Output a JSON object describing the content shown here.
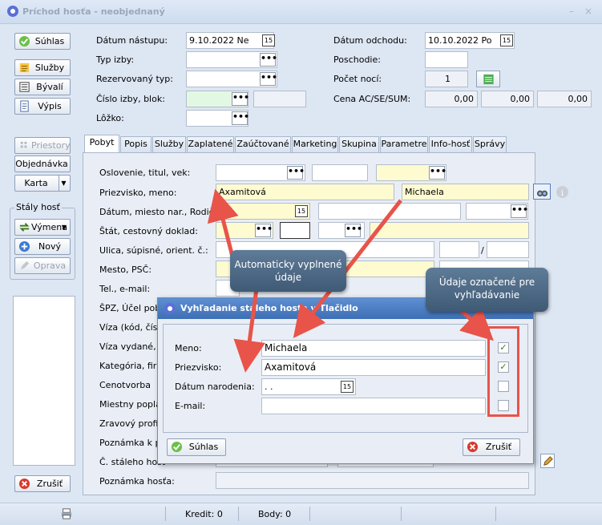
{
  "window": {
    "title": "Príchod hosťa - neobjednaný",
    "minimize": "–",
    "close": "×"
  },
  "left_buttons": {
    "suhlas": "Súhlas",
    "sluzby": "Služby",
    "byvali": "Bývalí",
    "vypis": "Výpis",
    "priestory": "Priestory",
    "objednavka": "Objednávka",
    "karta": "Karta",
    "staly_host": "Stály hosť",
    "vymena": "Výmena",
    "novy": "Nový",
    "oprava": "Oprava",
    "zrusit": "Zrušiť"
  },
  "header": {
    "datum_nastupu_label": "Dátum nástupu:",
    "datum_nastupu": "9.10.2022  Ne",
    "typ_izby_label": "Typ izby:",
    "rezervovany_typ_label": "Rezervovaný typ:",
    "cislo_izby_label": "Číslo izby, blok:",
    "lozko_label": "Lôžko:",
    "datum_odchodu_label": "Dátum odchodu:",
    "datum_odchodu": "10.10.2022  Po",
    "poschodie_label": "Poschodie:",
    "pocet_noci_label": "Počet nocí:",
    "pocet_noci": "1",
    "cena_label": "Cena AC/SE/SUM:",
    "cena_ac": "0,00",
    "cena_se": "0,00",
    "cena_sum": "0,00",
    "calendar_icon_text": "15"
  },
  "tabs": [
    "Pobyt",
    "Popis",
    "Služby",
    "Zaplatené",
    "Zaúčtované",
    "Marketing",
    "Skupina",
    "Parametre",
    "Info-hosť",
    "Správy"
  ],
  "form": {
    "oslovenie": "Oslovenie, titul, vek:",
    "priezvisko_meno": "Priezvisko, meno:",
    "priezvisko": "Axamitová",
    "meno": "Michaela",
    "datum_miesto": "Dátum, miesto nar., Rodič:",
    "datum_value": " .  .",
    "stat": "Štát, cestovný doklad:",
    "ulica": "Ulica, súpisné, orient. č.:",
    "slash": "/",
    "mesto": "Mesto, PSČ:",
    "tel": "Tel., e-mail:",
    "spz": "ŠPZ, Účel pob",
    "viza": "Víza (kód, čísl",
    "viza_vydane": "Víza vydané, p",
    "kategoria": "Kategória, firma",
    "cenotvorba": "Cenotvorba",
    "miestny": "Miestny poplato",
    "zravovy": "Zravový profil:",
    "poznamka_k": "Poznámka k po",
    "cislo_staleho": "Č. stáleho hosť",
    "poznamka_hosta": "Poznámka hosťa:"
  },
  "dialog": {
    "title": "Vyhľadanie stáleho hosťa v Tlačidlo",
    "meno_label": "Meno:",
    "meno": "Michaela",
    "priezvisko_label": "Priezvisko:",
    "priezvisko": "Axamitová",
    "datum_label": "Dátum narodenia:",
    "datum": " .  .",
    "email_label": "E-mail:",
    "suhlas": "Súhlas",
    "zrusit": "Zrušiť",
    "checks": [
      true,
      true,
      false,
      false
    ]
  },
  "callouts": {
    "auto": "Automaticky vyplnené údaje",
    "search": "Údaje označené pre vyhľadávanie"
  },
  "status": {
    "kredit": "Kredit: 0",
    "body": "Body: 0"
  },
  "colors": {
    "accent": "#e8544a",
    "callout": "#4f6b87",
    "yellow_field": "#fffbd0"
  }
}
